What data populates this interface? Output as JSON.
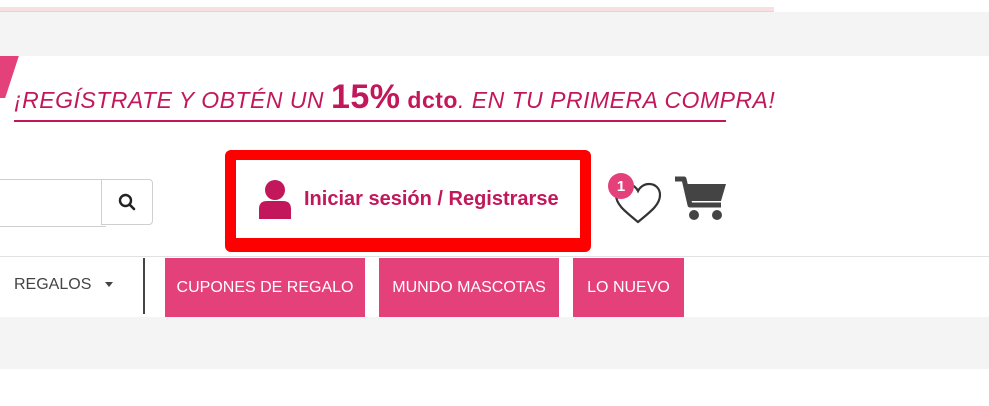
{
  "promo": {
    "prefix": "¡REGÍSTRATE Y OBTÉN UN ",
    "discount": "15%",
    "dcto": "dcto",
    "suffix": ". EN TU PRIMERA COMPRA!"
  },
  "search": {
    "value": "",
    "placeholder": ""
  },
  "account": {
    "login_label": "Iniciar sesión / Registrarse"
  },
  "wishlist": {
    "count": "1"
  },
  "nav": {
    "regalos_label": "REGALOS",
    "buttons": [
      {
        "label": "CUPONES DE REGALO"
      },
      {
        "label": "MUNDO MASCOTAS"
      },
      {
        "label": "LO NUEVO"
      }
    ]
  },
  "colors": {
    "brand_pink": "#e4407a",
    "brand_magenta": "#c2185b",
    "highlight_red": "#ff0000"
  },
  "icons": [
    "search-icon",
    "user-icon",
    "heart-icon",
    "cart-icon",
    "caret-down-icon"
  ]
}
